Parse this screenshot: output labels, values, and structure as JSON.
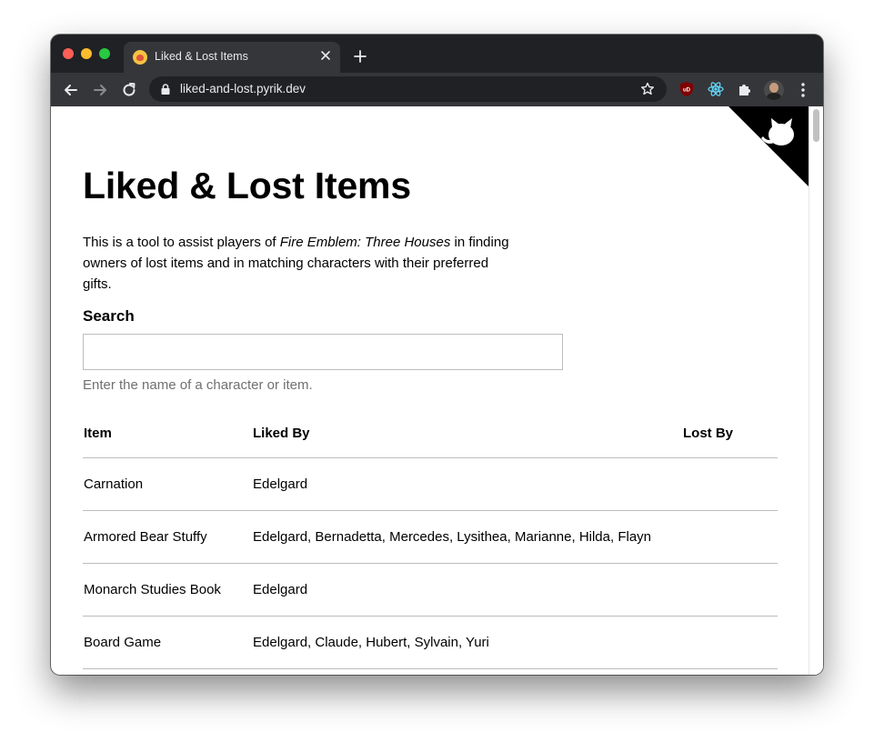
{
  "browser": {
    "tab_title": "Liked & Lost Items",
    "url": "liked-and-lost.pyrik.dev",
    "extensions": [
      "ublock-origin-icon",
      "react-devtools-icon",
      "puzzle-icon"
    ],
    "theme": {
      "frame": "#202124",
      "toolbar": "#35363a",
      "text": "#e8eaed"
    }
  },
  "page": {
    "title": "Liked & Lost Items",
    "intro": {
      "before": "This is a tool to assist players of ",
      "game": "Fire Emblem: Three Houses",
      "after": " in finding owners of lost items and in matching characters with their preferred gifts."
    },
    "search": {
      "label": "Search",
      "value": "",
      "placeholder": "",
      "hint": "Enter the name of a character or item."
    },
    "table": {
      "headers": {
        "item": "Item",
        "liked_by": "Liked By",
        "lost_by": "Lost By"
      },
      "rows": [
        {
          "item": "Carnation",
          "liked_by": "Edelgard",
          "lost_by": ""
        },
        {
          "item": "Armored Bear Stuffy",
          "liked_by": "Edelgard, Bernadetta, Mercedes, Lysithea, Marianne, Hilda, Flayn",
          "lost_by": ""
        },
        {
          "item": "Monarch Studies Book",
          "liked_by": "Edelgard",
          "lost_by": ""
        },
        {
          "item": "Board Game",
          "liked_by": "Edelgard, Claude, Hubert, Sylvain, Yuri",
          "lost_by": ""
        }
      ]
    }
  }
}
